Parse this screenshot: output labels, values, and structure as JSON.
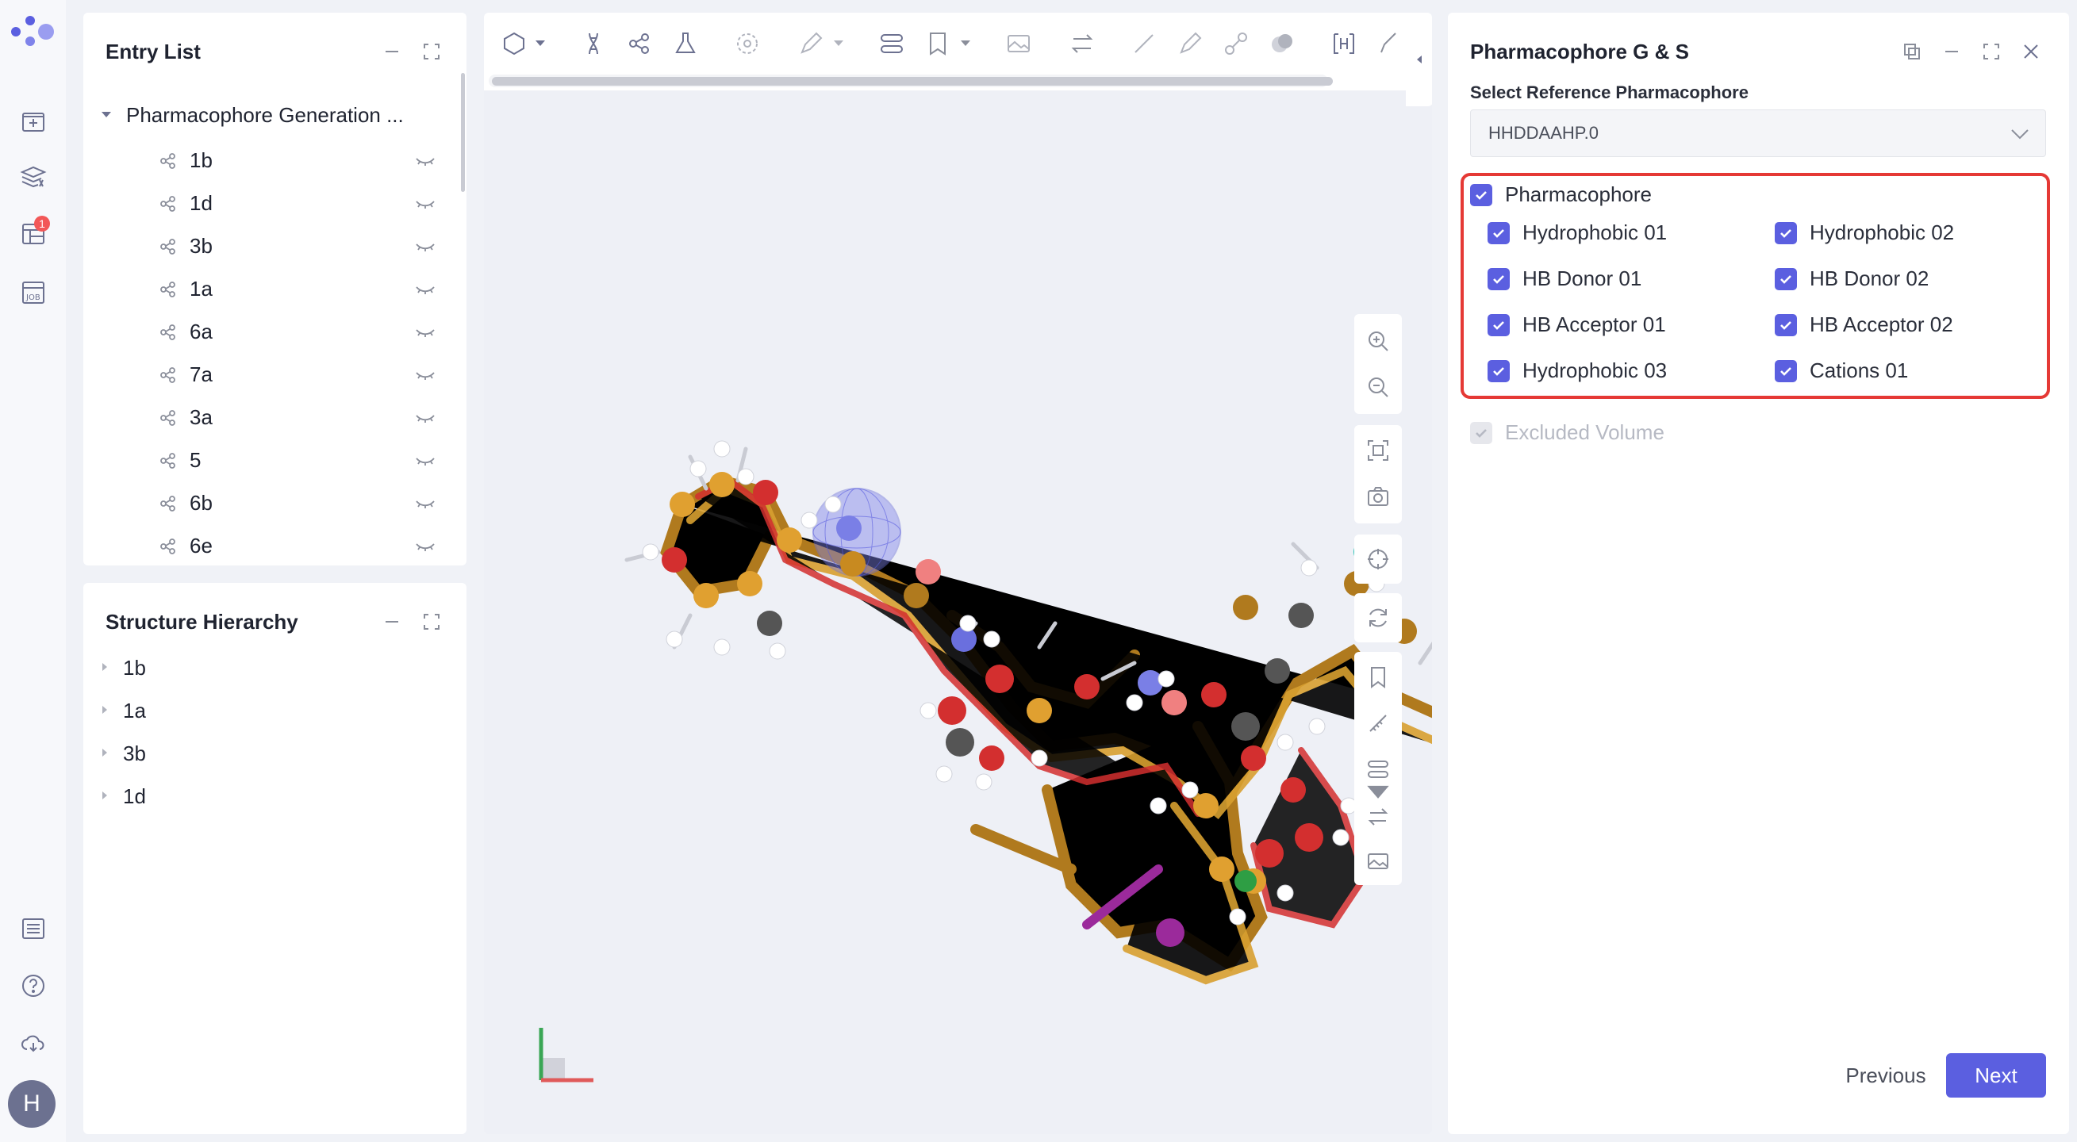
{
  "colors": {
    "accent": "#5b5fe0",
    "highlight": "#e53935",
    "badge": "#f25757"
  },
  "rail": {
    "icons": [
      "new-project-icon",
      "layers-icon",
      "table-icon",
      "job-icon",
      "list-icon",
      "help-icon",
      "cloud-icon"
    ],
    "badge_count": "1",
    "avatar_letter": "H"
  },
  "entry_list": {
    "title": "Entry List",
    "root_label": "Pharmacophore Generation ...",
    "items": [
      {
        "label": "1b"
      },
      {
        "label": "1d"
      },
      {
        "label": "3b"
      },
      {
        "label": "1a"
      },
      {
        "label": "6a"
      },
      {
        "label": "7a"
      },
      {
        "label": "3a"
      },
      {
        "label": "5"
      },
      {
        "label": "6b"
      },
      {
        "label": "6e"
      }
    ]
  },
  "structure_hierarchy": {
    "title": "Structure Hierarchy",
    "items": [
      {
        "label": "1b"
      },
      {
        "label": "1a"
      },
      {
        "label": "3b"
      },
      {
        "label": "1d"
      }
    ]
  },
  "pharmacophore": {
    "title": "Pharmacophore G & S",
    "select_label": "Select Reference Pharmacophore",
    "selected": "HHDDAAHP.0",
    "group_label": "Pharmacophore",
    "features": [
      {
        "label": "Hydrophobic 01",
        "checked": true
      },
      {
        "label": "Hydrophobic 02",
        "checked": true
      },
      {
        "label": "HB Donor 01",
        "checked": true
      },
      {
        "label": "HB Donor 02",
        "checked": true
      },
      {
        "label": "HB Acceptor 01",
        "checked": true
      },
      {
        "label": "HB Acceptor 02",
        "checked": true
      },
      {
        "label": "Hydrophobic 03",
        "checked": true
      },
      {
        "label": "Cations 01",
        "checked": true
      }
    ],
    "excluded_volume": "Excluded Volume",
    "previous": "Previous",
    "next": "Next"
  }
}
